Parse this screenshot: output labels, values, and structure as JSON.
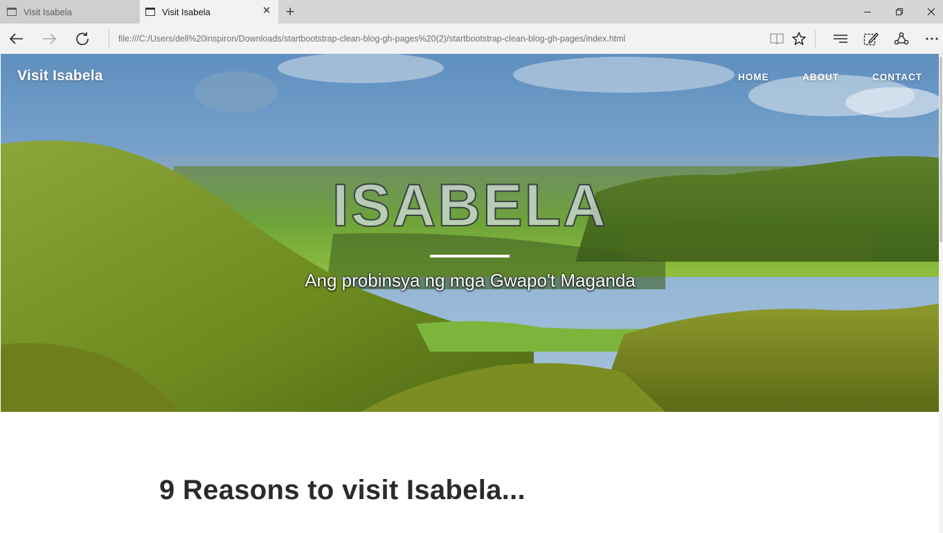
{
  "browser": {
    "tabs": [
      {
        "title": "Visit Isabela",
        "active": false
      },
      {
        "title": "Visit Isabela",
        "active": true
      }
    ],
    "close_tab_glyph": "✕",
    "new_tab_glyph": "+",
    "address": "file:///C:/Users/dell%20inspiron/Downloads/startbootstrap-clean-blog-gh-pages%20(2)/startbootstrap-clean-blog-gh-pages/index.html",
    "icons": [
      "back-icon",
      "forward-icon",
      "refresh-icon",
      "reading-view-icon",
      "favorite-star-icon",
      "hub-icon",
      "web-note-icon",
      "share-icon",
      "more-icon",
      "minimize-icon",
      "maximize-icon",
      "window-close-icon"
    ]
  },
  "site": {
    "brand": "Visit Isabela",
    "nav": [
      {
        "label": "HOME"
      },
      {
        "label": "ABOUT"
      },
      {
        "label": "CONTACT"
      }
    ],
    "hero": {
      "title": "ISABELA",
      "subtitle": "Ang probinsya ng mga Gwapo't Maganda"
    },
    "post_title": "9 Reasons to visit Isabela..."
  },
  "colors": {
    "tab_strip": "#d6d6d6",
    "toolbar": "#f2f2f2",
    "sky": "#6f9cc8",
    "hill_green": "#7d9a2c",
    "text_dark": "#2b2b2b"
  }
}
